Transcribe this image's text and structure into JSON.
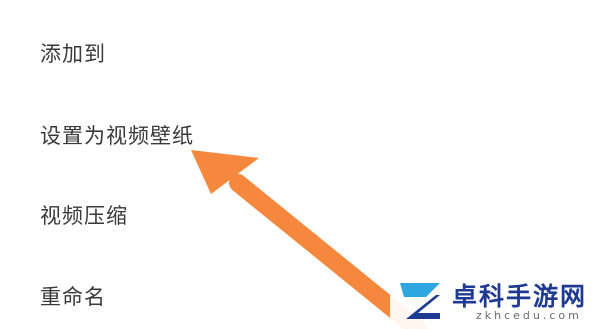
{
  "menu": {
    "items": [
      {
        "label": "添加到"
      },
      {
        "label": "设置为视频壁纸"
      },
      {
        "label": "视频压缩"
      },
      {
        "label": "重命名"
      }
    ]
  },
  "annotation": {
    "arrow_color": "#F5883C",
    "points_to": "设置为视频壁纸"
  },
  "watermark": {
    "title": "卓科手游网",
    "subtitle": "zkhcedu.com",
    "logo_colors": [
      "#1F3A93",
      "#2EA6E0"
    ]
  }
}
